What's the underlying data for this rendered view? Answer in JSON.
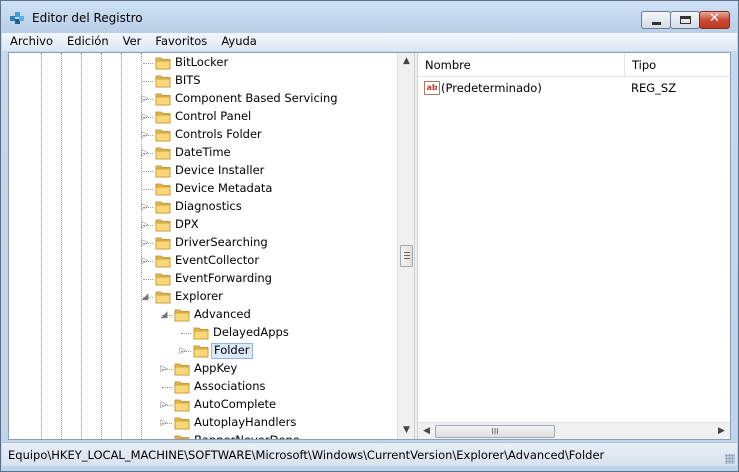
{
  "window": {
    "title": "Editor del Registro"
  },
  "menu": [
    "Archivo",
    "Edición",
    "Ver",
    "Favoritos",
    "Ayuda"
  ],
  "tree": {
    "items": [
      {
        "label": "BitLocker",
        "level": 0,
        "expander": ""
      },
      {
        "label": "BITS",
        "level": 0,
        "expander": ""
      },
      {
        "label": "Component Based Servicing",
        "level": 0,
        "expander": "▷"
      },
      {
        "label": "Control Panel",
        "level": 0,
        "expander": "▷"
      },
      {
        "label": "Controls Folder",
        "level": 0,
        "expander": "▷"
      },
      {
        "label": "DateTime",
        "level": 0,
        "expander": "▷"
      },
      {
        "label": "Device Installer",
        "level": 0,
        "expander": ""
      },
      {
        "label": "Device Metadata",
        "level": 0,
        "expander": ""
      },
      {
        "label": "Diagnostics",
        "level": 0,
        "expander": "▷"
      },
      {
        "label": "DPX",
        "level": 0,
        "expander": "▷"
      },
      {
        "label": "DriverSearching",
        "level": 0,
        "expander": "▷"
      },
      {
        "label": "EventCollector",
        "level": 0,
        "expander": "▷"
      },
      {
        "label": "EventForwarding",
        "level": 0,
        "expander": ""
      },
      {
        "label": "Explorer",
        "level": 0,
        "expander": "◢"
      },
      {
        "label": "Advanced",
        "level": 1,
        "expander": "◢"
      },
      {
        "label": "DelayedApps",
        "level": 2,
        "expander": ""
      },
      {
        "label": "Folder",
        "level": 2,
        "expander": "▷",
        "selected": true
      },
      {
        "label": "AppKey",
        "level": 1,
        "expander": "▷"
      },
      {
        "label": "Associations",
        "level": 1,
        "expander": ""
      },
      {
        "label": "AutoComplete",
        "level": 1,
        "expander": "▷"
      },
      {
        "label": "AutoplayHandlers",
        "level": 1,
        "expander": "▷"
      },
      {
        "label": "BannerNeverDone",
        "level": 1,
        "expander": ""
      }
    ]
  },
  "list": {
    "columns": [
      "Nombre",
      "Tipo"
    ],
    "rows": [
      {
        "name": "(Predeterminado)",
        "type": "REG_SZ",
        "icon": "ab-string-icon"
      }
    ]
  },
  "scroll": {
    "thumb_grip": "III"
  },
  "status": {
    "path": "Equipo\\HKEY_LOCAL_MACHINE\\SOFTWARE\\Microsoft\\Windows\\CurrentVersion\\Explorer\\Advanced\\Folder"
  }
}
